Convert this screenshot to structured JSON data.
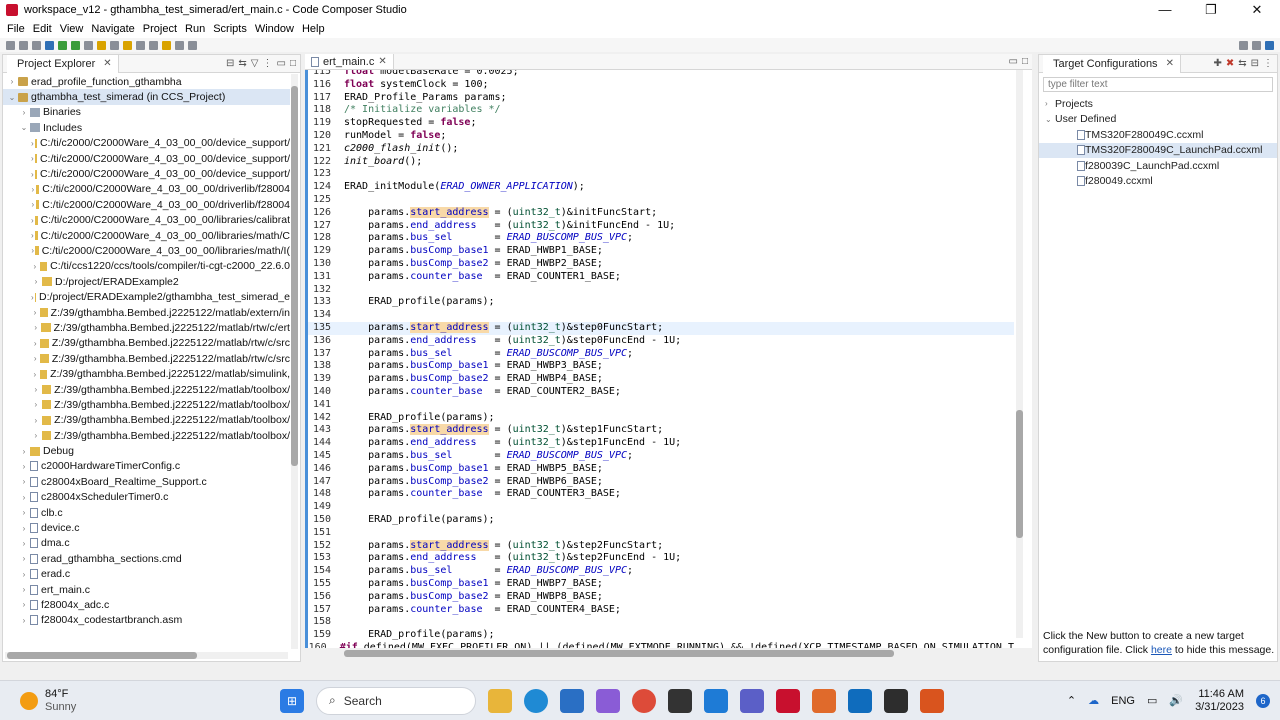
{
  "window": {
    "title": "workspace_v12 - gthambha_test_simerad/ert_main.c - Code Composer Studio",
    "controls": [
      "—",
      "❐",
      "✕"
    ]
  },
  "menu": [
    "File",
    "Edit",
    "View",
    "Navigate",
    "Project",
    "Run",
    "Scripts",
    "Window",
    "Help"
  ],
  "project_explorer": {
    "tab_label": "Project Explorer",
    "items": [
      {
        "label": "erad_profile_function_gthambha",
        "indent": 0,
        "arrow": "›",
        "icon": "proj"
      },
      {
        "label": "gthambha_test_simerad  (in CCS_Project)",
        "indent": 0,
        "arrow": "⌄",
        "icon": "proj",
        "selected": true
      },
      {
        "label": "Binaries",
        "indent": 1,
        "arrow": "›",
        "icon": "lib"
      },
      {
        "label": "Includes",
        "indent": 1,
        "arrow": "⌄",
        "icon": "lib"
      },
      {
        "label": "C:/ti/c2000/C2000Ware_4_03_00_00/device_support/",
        "indent": 2,
        "arrow": "›",
        "icon": "folder"
      },
      {
        "label": "C:/ti/c2000/C2000Ware_4_03_00_00/device_support/",
        "indent": 2,
        "arrow": "›",
        "icon": "folder"
      },
      {
        "label": "C:/ti/c2000/C2000Ware_4_03_00_00/device_support/",
        "indent": 2,
        "arrow": "›",
        "icon": "folder"
      },
      {
        "label": "C:/ti/c2000/C2000Ware_4_03_00_00/driverlib/f28004",
        "indent": 2,
        "arrow": "›",
        "icon": "folder"
      },
      {
        "label": "C:/ti/c2000/C2000Ware_4_03_00_00/driverlib/f28004",
        "indent": 2,
        "arrow": "›",
        "icon": "folder"
      },
      {
        "label": "C:/ti/c2000/C2000Ware_4_03_00_00/libraries/calibrat",
        "indent": 2,
        "arrow": "›",
        "icon": "folder"
      },
      {
        "label": "C:/ti/c2000/C2000Ware_4_03_00_00/libraries/math/C",
        "indent": 2,
        "arrow": "›",
        "icon": "folder"
      },
      {
        "label": "C:/ti/c2000/C2000Ware_4_03_00_00/libraries/math/I(",
        "indent": 2,
        "arrow": "›",
        "icon": "folder"
      },
      {
        "label": "C:/ti/ccs1220/ccs/tools/compiler/ti-cgt-c2000_22.6.0",
        "indent": 2,
        "arrow": "›",
        "icon": "folder"
      },
      {
        "label": "D:/project/ERADExample2",
        "indent": 2,
        "arrow": "›",
        "icon": "folder"
      },
      {
        "label": "D:/project/ERADExample2/gthambha_test_simerad_e",
        "indent": 2,
        "arrow": "›",
        "icon": "folder"
      },
      {
        "label": "Z:/39/gthambha.Bembed.j2225122/matlab/extern/in",
        "indent": 2,
        "arrow": "›",
        "icon": "folder"
      },
      {
        "label": "Z:/39/gthambha.Bembed.j2225122/matlab/rtw/c/ert",
        "indent": 2,
        "arrow": "›",
        "icon": "folder"
      },
      {
        "label": "Z:/39/gthambha.Bembed.j2225122/matlab/rtw/c/src",
        "indent": 2,
        "arrow": "›",
        "icon": "folder"
      },
      {
        "label": "Z:/39/gthambha.Bembed.j2225122/matlab/rtw/c/src",
        "indent": 2,
        "arrow": "›",
        "icon": "folder"
      },
      {
        "label": "Z:/39/gthambha.Bembed.j2225122/matlab/simulink,",
        "indent": 2,
        "arrow": "›",
        "icon": "folder"
      },
      {
        "label": "Z:/39/gthambha.Bembed.j2225122/matlab/toolbox/",
        "indent": 2,
        "arrow": "›",
        "icon": "folder"
      },
      {
        "label": "Z:/39/gthambha.Bembed.j2225122/matlab/toolbox/",
        "indent": 2,
        "arrow": "›",
        "icon": "folder"
      },
      {
        "label": "Z:/39/gthambha.Bembed.j2225122/matlab/toolbox/",
        "indent": 2,
        "arrow": "›",
        "icon": "folder"
      },
      {
        "label": "Z:/39/gthambha.Bembed.j2225122/matlab/toolbox/",
        "indent": 2,
        "arrow": "›",
        "icon": "folder"
      },
      {
        "label": "Debug",
        "indent": 1,
        "arrow": "›",
        "icon": "folder"
      },
      {
        "label": "c2000HardwareTimerConfig.c",
        "indent": 1,
        "arrow": "›",
        "icon": "file"
      },
      {
        "label": "c28004xBoard_Realtime_Support.c",
        "indent": 1,
        "arrow": "›",
        "icon": "file"
      },
      {
        "label": "c28004xSchedulerTimer0.c",
        "indent": 1,
        "arrow": "›",
        "icon": "file"
      },
      {
        "label": "clb.c",
        "indent": 1,
        "arrow": "›",
        "icon": "file"
      },
      {
        "label": "device.c",
        "indent": 1,
        "arrow": "›",
        "icon": "file"
      },
      {
        "label": "dma.c",
        "indent": 1,
        "arrow": "›",
        "icon": "file"
      },
      {
        "label": "erad_gthambha_sections.cmd",
        "indent": 1,
        "arrow": "›",
        "icon": "file"
      },
      {
        "label": "erad.c",
        "indent": 1,
        "arrow": "›",
        "icon": "file"
      },
      {
        "label": "ert_main.c",
        "indent": 1,
        "arrow": "›",
        "icon": "file"
      },
      {
        "label": "f28004x_adc.c",
        "indent": 1,
        "arrow": "›",
        "icon": "file"
      },
      {
        "label": "f28004x_codestartbranch.asm",
        "indent": 1,
        "arrow": "›",
        "icon": "file"
      }
    ]
  },
  "editor": {
    "tab_label": "ert_main.c",
    "current_line": "135",
    "lines": [
      {
        "n": "115",
        "html": "<span class=\"kw\">float</span> modelBaseRate = 0.0025;"
      },
      {
        "n": "116",
        "html": "<span class=\"kw\">float</span> systemClock = 100;"
      },
      {
        "n": "117",
        "html": "ERAD_Profile_Params params;"
      },
      {
        "n": "118",
        "html": "<span class=\"cm\">/* Initialize variables */</span>"
      },
      {
        "n": "119",
        "html": "stopRequested = <span class=\"kw\">false</span>;"
      },
      {
        "n": "120",
        "html": "runModel = <span class=\"kw\">false</span>;"
      },
      {
        "n": "121",
        "html": "<i>c2000_flash_init</i>();"
      },
      {
        "n": "122",
        "html": "<i>init_board</i>();"
      },
      {
        "n": "123",
        "html": ""
      },
      {
        "n": "124",
        "html": "ERAD_initModule(<span class=\"en\">ERAD_OWNER_APPLICATION</span>);"
      },
      {
        "n": "125",
        "html": ""
      },
      {
        "n": "126",
        "html": "    params.<span class=\"fld hl\">start_address</span> = (<span class=\"ty\">uint32_t</span>)&amp;initFuncStart;"
      },
      {
        "n": "127",
        "html": "    params.<span class=\"fld\">end_address</span>   = (<span class=\"ty\">uint32_t</span>)&amp;initFuncEnd - 1U;"
      },
      {
        "n": "128",
        "html": "    params.<span class=\"fld\">bus_sel</span>       = <span class=\"en\">ERAD_BUSCOMP_BUS_VPC</span>;"
      },
      {
        "n": "129",
        "html": "    params.<span class=\"fld\">busComp_base1</span> = ERAD_HWBP1_BASE;"
      },
      {
        "n": "130",
        "html": "    params.<span class=\"fld\">busComp_base2</span> = ERAD_HWBP2_BASE;"
      },
      {
        "n": "131",
        "html": "    params.<span class=\"fld\">counter_base</span>  = ERAD_COUNTER1_BASE;"
      },
      {
        "n": "132",
        "html": ""
      },
      {
        "n": "133",
        "html": "    ERAD_profile(params);"
      },
      {
        "n": "134",
        "html": ""
      },
      {
        "n": "135",
        "html": "    params.<span class=\"fld hl\">start_address</span> = (<span class=\"ty\">uint32_t</span>)&amp;step0FuncStart;"
      },
      {
        "n": "136",
        "html": "    params.<span class=\"fld\">end_address</span>   = (<span class=\"ty\">uint32_t</span>)&amp;step0FuncEnd - 1U;"
      },
      {
        "n": "137",
        "html": "    params.<span class=\"fld\">bus_sel</span>       = <span class=\"en\">ERAD_BUSCOMP_BUS_VPC</span>;"
      },
      {
        "n": "138",
        "html": "    params.<span class=\"fld\">busComp_base1</span> = ERAD_HWBP3_BASE;"
      },
      {
        "n": "139",
        "html": "    params.<span class=\"fld\">busComp_base2</span> = ERAD_HWBP4_BASE;"
      },
      {
        "n": "140",
        "html": "    params.<span class=\"fld\">counter_base</span>  = ERAD_COUNTER2_BASE;"
      },
      {
        "n": "141",
        "html": ""
      },
      {
        "n": "142",
        "html": "    ERAD_profile(params);"
      },
      {
        "n": "143",
        "html": "    params.<span class=\"fld hl\">start_address</span> = (<span class=\"ty\">uint32_t</span>)&amp;step1FuncStart;"
      },
      {
        "n": "144",
        "html": "    params.<span class=\"fld\">end_address</span>   = (<span class=\"ty\">uint32_t</span>)&amp;step1FuncEnd - 1U;"
      },
      {
        "n": "145",
        "html": "    params.<span class=\"fld\">bus_sel</span>       = <span class=\"en\">ERAD_BUSCOMP_BUS_VPC</span>;"
      },
      {
        "n": "146",
        "html": "    params.<span class=\"fld\">busComp_base1</span> = ERAD_HWBP5_BASE;"
      },
      {
        "n": "147",
        "html": "    params.<span class=\"fld\">busComp_base2</span> = ERAD_HWBP6_BASE;"
      },
      {
        "n": "148",
        "html": "    params.<span class=\"fld\">counter_base</span>  = ERAD_COUNTER3_BASE;"
      },
      {
        "n": "149",
        "html": ""
      },
      {
        "n": "150",
        "html": "    ERAD_profile(params);"
      },
      {
        "n": "151",
        "html": ""
      },
      {
        "n": "152",
        "html": "    params.<span class=\"fld hl\">start_address</span> = (<span class=\"ty\">uint32_t</span>)&amp;step2FuncStart;"
      },
      {
        "n": "153",
        "html": "    params.<span class=\"fld\">end_address</span>   = (<span class=\"ty\">uint32_t</span>)&amp;step2FuncEnd - 1U;"
      },
      {
        "n": "154",
        "html": "    params.<span class=\"fld\">bus_sel</span>       = <span class=\"en\">ERAD_BUSCOMP_BUS_VPC</span>;"
      },
      {
        "n": "155",
        "html": "    params.<span class=\"fld\">busComp_base1</span> = ERAD_HWBP7_BASE;"
      },
      {
        "n": "156",
        "html": "    params.<span class=\"fld\">busComp_base2</span> = ERAD_HWBP8_BASE;"
      },
      {
        "n": "157",
        "html": "    params.<span class=\"fld\">counter_base</span>  = ERAD_COUNTER4_BASE;"
      },
      {
        "n": "158",
        "html": ""
      },
      {
        "n": "159",
        "html": "    ERAD_profile(params);"
      },
      {
        "n": "160",
        "html": "<span class=\"kw\">#if</span> defined(MW_EXEC_PROFILER_ON) || (defined(MW_EXTMODE_RUNNING) &amp;&amp; !defined(XCP_TIMESTAMP_BASED_ON_SIMULATION_T"
      }
    ]
  },
  "target_config": {
    "tab_label": "Target Configurations",
    "filter_placeholder": "type filter text",
    "items": [
      {
        "label": "Projects",
        "indent": 0,
        "arrow": "›",
        "icon": "folder"
      },
      {
        "label": "User Defined",
        "indent": 0,
        "arrow": "⌄",
        "icon": "folder"
      },
      {
        "label": "TMS320F280049C.ccxml",
        "indent": 1,
        "arrow": "",
        "icon": "file"
      },
      {
        "label": "TMS320F280049C_LaunchPad.ccxml",
        "indent": 1,
        "arrow": "",
        "icon": "file",
        "selected": true
      },
      {
        "label": "f280039C_LaunchPad.ccxml",
        "indent": 1,
        "arrow": "",
        "icon": "file"
      },
      {
        "label": "f280049.ccxml",
        "indent": 1,
        "arrow": "",
        "icon": "file"
      }
    ],
    "note_before": "Click the New button to create a new target configuration file. Click ",
    "note_link": "here",
    "note_after": " to hide this message."
  },
  "taskbar": {
    "weather_temp": "84°F",
    "weather_cond": "Sunny",
    "search_label": "Search",
    "language": "ENG",
    "time": "11:46 AM",
    "date": "3/31/2023",
    "notif_count": "6"
  }
}
